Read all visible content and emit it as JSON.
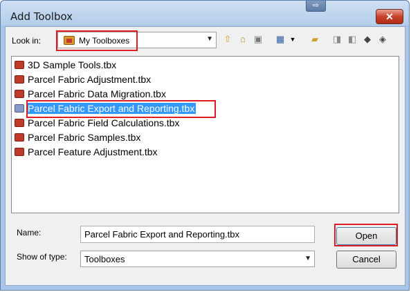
{
  "window": {
    "title": "Add Toolbox",
    "close_glyph": "✕",
    "drag_glyph": "⇨"
  },
  "lookin": {
    "label": "Look in:",
    "value": "My Toolboxes",
    "icon": "toolbox-folder-icon"
  },
  "toolbar": {
    "icons": [
      "up-one-level-icon",
      "home-icon",
      "connect-folder-icon",
      "view-menu-icon",
      "new-folder-icon",
      "catalog-icons"
    ]
  },
  "files": [
    {
      "label": "3D Sample Tools.tbx",
      "selected": false
    },
    {
      "label": "Parcel Fabric Adjustment.tbx",
      "selected": false
    },
    {
      "label": "Parcel Fabric Data Migration.tbx",
      "selected": false
    },
    {
      "label": "Parcel Fabric Export and Reporting.tbx",
      "selected": true
    },
    {
      "label": "Parcel Fabric Field Calculations.tbx",
      "selected": false
    },
    {
      "label": "Parcel Fabric Samples.tbx",
      "selected": false
    },
    {
      "label": "Parcel Feature Adjustment.tbx",
      "selected": false
    }
  ],
  "name": {
    "label": "Name:",
    "value": "Parcel Fabric Export and Reporting.tbx"
  },
  "type": {
    "label": "Show of type:",
    "value": "Toolboxes"
  },
  "buttons": {
    "open": "Open",
    "cancel": "Cancel"
  },
  "colors": {
    "highlight_box": "#e01b22",
    "selection": "#3399ff"
  }
}
